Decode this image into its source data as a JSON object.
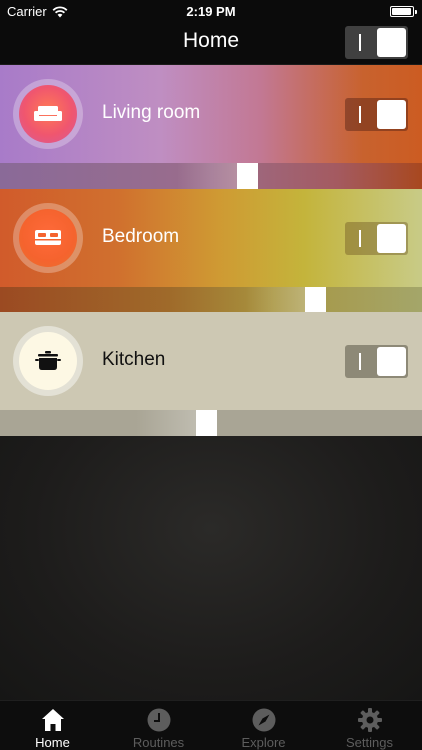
{
  "status_bar": {
    "carrier": "Carrier",
    "time": "2:19 PM"
  },
  "nav": {
    "title": "Home",
    "all_lights_on": true
  },
  "rooms": [
    {
      "name": "Living room",
      "icon": "sofa-icon",
      "on": true,
      "brightness": 0.59
    },
    {
      "name": "Bedroom",
      "icon": "bed-icon",
      "on": true,
      "brightness": 0.76
    },
    {
      "name": "Kitchen",
      "icon": "cooking-pot-icon",
      "on": true,
      "brightness": 0.49
    }
  ],
  "tab_bar": {
    "tabs": [
      {
        "label": "Home",
        "icon": "house-icon",
        "active": true
      },
      {
        "label": "Routines",
        "icon": "clock-icon",
        "active": false
      },
      {
        "label": "Explore",
        "icon": "compass-icon",
        "active": false
      },
      {
        "label": "Settings",
        "icon": "gear-icon",
        "active": false
      }
    ]
  },
  "colors": {
    "living_room_start": "#a87bc9",
    "living_room_end": "#cc5c22",
    "bedroom_start": "#d15b2b",
    "bedroom_end": "#c8cb87",
    "kitchen": "#cdc8b3",
    "bar_background": "#0b0b0b"
  }
}
